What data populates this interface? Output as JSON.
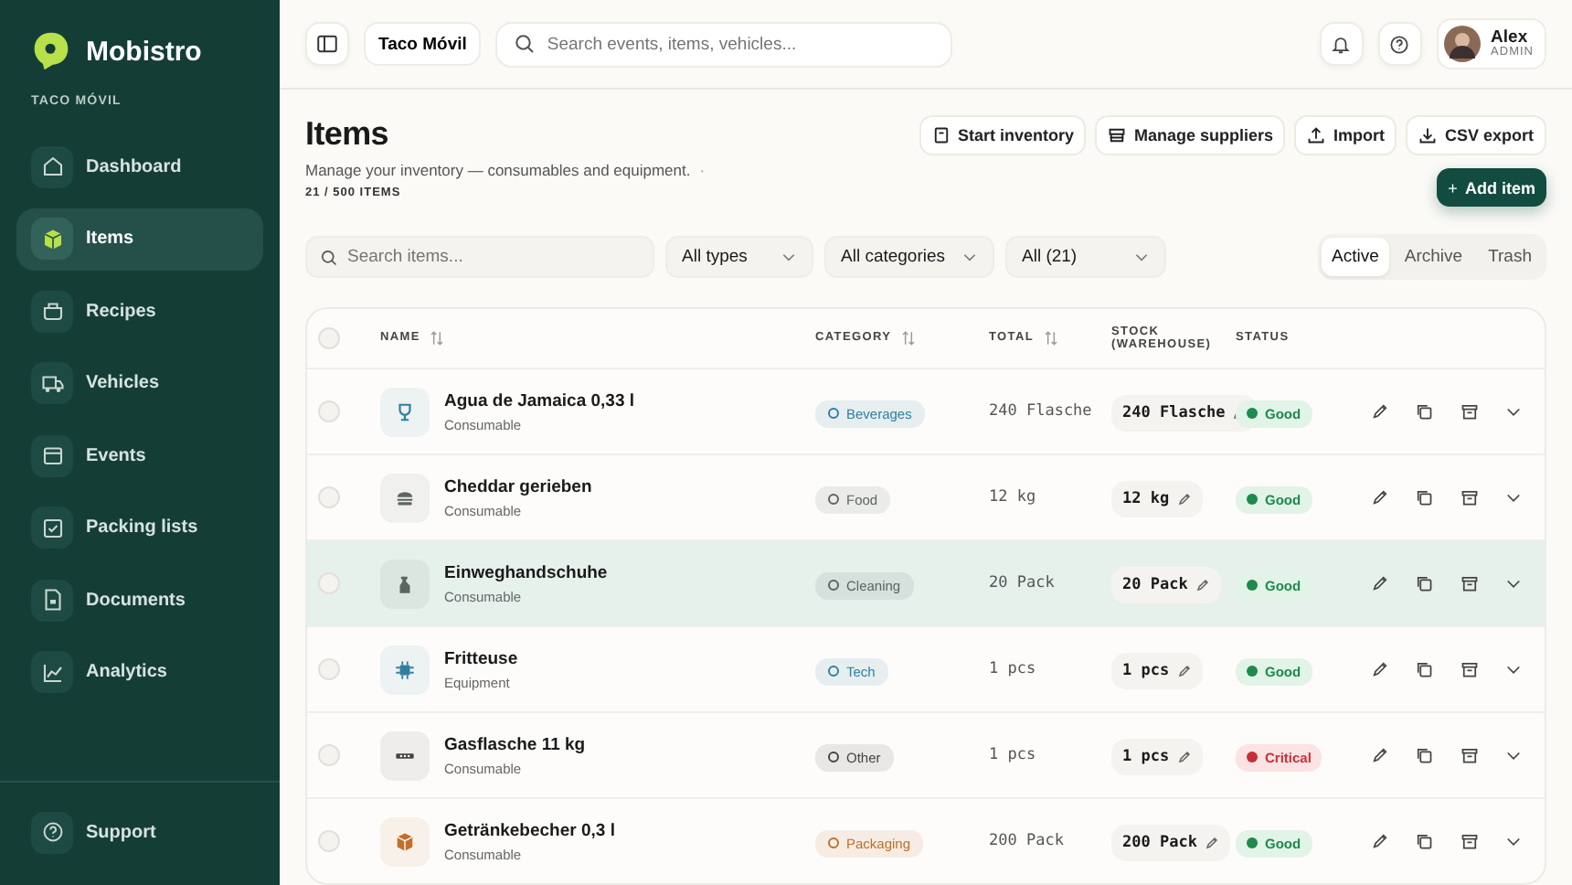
{
  "app": {
    "name": "Mobistro",
    "workspace": "TACO MÓVIL"
  },
  "sidebar": {
    "items": [
      {
        "label": "Dashboard",
        "kind": "home",
        "selected": false
      },
      {
        "label": "Items",
        "kind": "box",
        "selected": true
      },
      {
        "label": "Recipes",
        "kind": "pot",
        "selected": false
      },
      {
        "label": "Vehicles",
        "kind": "truck",
        "selected": false
      },
      {
        "label": "Events",
        "kind": "calendar",
        "selected": false
      },
      {
        "label": "Packing lists",
        "kind": "checklist",
        "selected": false
      },
      {
        "label": "Documents",
        "kind": "document",
        "selected": false
      },
      {
        "label": "Analytics",
        "kind": "chart",
        "selected": false
      }
    ],
    "footer": {
      "label": "Support"
    }
  },
  "topbar": {
    "workspace_button": "Taco Móvil",
    "search": {
      "placeholder": "Search events, items, vehicles..."
    },
    "user": {
      "name": "Alex",
      "role": "ADMIN"
    }
  },
  "page": {
    "title": "Items",
    "subtitle": "Manage your inventory — consumables and equipment.",
    "separator": "·",
    "count": "21 / 500 ITEMS",
    "actions": [
      {
        "label": "Start inventory",
        "kind": "clipboard"
      },
      {
        "label": "Manage suppliers",
        "kind": "store"
      },
      {
        "label": "Import",
        "kind": "upload"
      },
      {
        "label": "CSV export",
        "kind": "download"
      }
    ],
    "primary_action": "Add item",
    "primary_icon": "+"
  },
  "filters": {
    "search": {
      "placeholder": "Search items..."
    },
    "selects": [
      "All types",
      "All categories",
      "All (21)"
    ],
    "tabs": [
      {
        "label": "Active",
        "selected": true
      },
      {
        "label": "Archive",
        "selected": false
      },
      {
        "label": "Trash",
        "selected": false
      }
    ]
  },
  "table": {
    "all_checked": false,
    "columns": [
      {
        "label": "NAME",
        "sortable": true
      },
      {
        "label": "CATEGORY",
        "sortable": true
      },
      {
        "label": "TOTAL",
        "sortable": true
      },
      {
        "label": "STOCK (WAREHOUSE)",
        "sortable": false
      },
      {
        "label": "STATUS",
        "sortable": false
      }
    ],
    "rows": [
      {
        "name": "Agua de Jamaica 0,33 l",
        "type": "Consumable",
        "kind": "glass",
        "category": {
          "label": "Beverages",
          "color": "#2f7fa0"
        },
        "total": "240 Flasche",
        "stock": "240 Flasche",
        "status": {
          "label": "Good",
          "kind": "good"
        },
        "checked": false,
        "highlighted": false
      },
      {
        "name": "Cheddar gerieben",
        "type": "Consumable",
        "kind": "burger",
        "category": {
          "label": "Food",
          "color": "#5b6660"
        },
        "total": "12 kg",
        "stock": "12 kg",
        "status": {
          "label": "Good",
          "kind": "good"
        },
        "checked": false,
        "highlighted": false
      },
      {
        "name": "Einweghandschuhe",
        "type": "Consumable",
        "kind": "spray",
        "category": {
          "label": "Cleaning",
          "color": "#5b6660"
        },
        "total": "20 Pack",
        "stock": "20 Pack",
        "status": {
          "label": "Good",
          "kind": "good"
        },
        "checked": false,
        "highlighted": true
      },
      {
        "name": "Fritteuse",
        "type": "Equipment",
        "kind": "chip",
        "category": {
          "label": "Tech",
          "color": "#2f7fa0"
        },
        "total": "1 pcs",
        "stock": "1 pcs",
        "status": {
          "label": "Good",
          "kind": "good"
        },
        "checked": false,
        "highlighted": false
      },
      {
        "name": "Gasflasche 11 kg",
        "type": "Consumable",
        "kind": "dots",
        "category": {
          "label": "Other",
          "color": "#444444"
        },
        "total": "1 pcs",
        "stock": "1 pcs",
        "status": {
          "label": "Critical",
          "kind": "critical"
        },
        "checked": false,
        "highlighted": false
      },
      {
        "name": "Getränkebecher 0,3 l",
        "type": "Consumable",
        "kind": "box",
        "category": {
          "label": "Packaging",
          "color": "#c0702a"
        },
        "total": "200 Pack",
        "stock": "200 Pack",
        "status": {
          "label": "Good",
          "kind": "good"
        },
        "checked": false,
        "highlighted": false
      }
    ]
  }
}
